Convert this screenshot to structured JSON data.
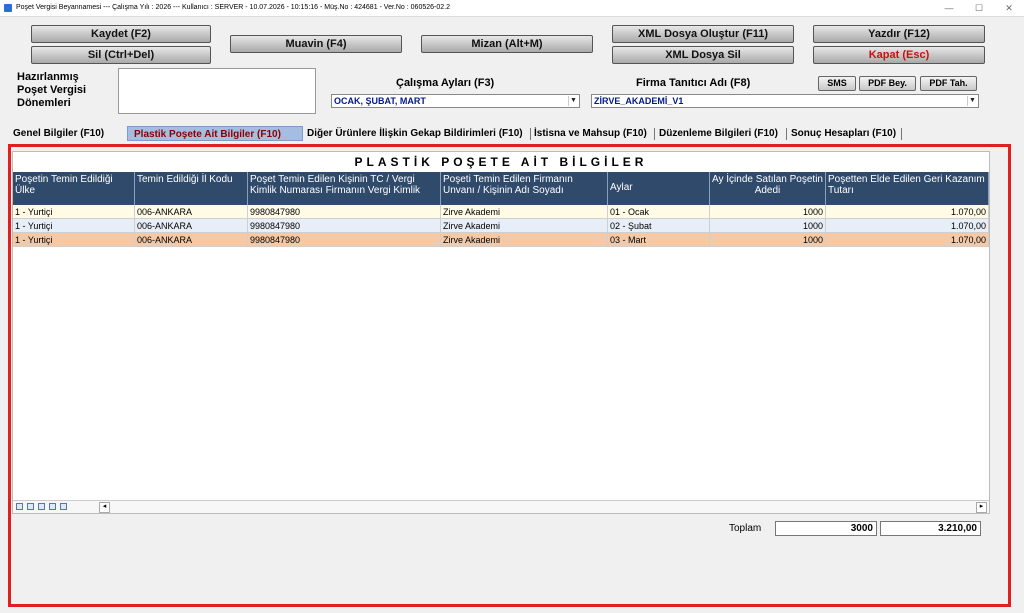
{
  "window": {
    "title": "Poşet Vergisi Beyannamesi  ---  Çalışma Yılı : 2026  ---  Kullanıcı : SERVER - 10.07.2026 - 10:15:16 - Müş.No : 424681 - Ver.No : 060526-02.2",
    "min": "—",
    "max": "☐",
    "close": "✕"
  },
  "toolbar": {
    "kaydet": "Kaydet (F2)",
    "sil": "Sil (Ctrl+Del)",
    "muavin": "Muavin (F4)",
    "mizan": "Mizan (Alt+M)",
    "xml_olustur": "XML Dosya Oluştur (F11)",
    "xml_sil": "XML Dosya Sil",
    "yazdir": "Yazdır (F12)",
    "kapat": "Kapat (Esc)"
  },
  "prepared": {
    "label_line1": "Hazırlanmış",
    "label_line2": "Poşet Vergisi",
    "label_line3": "Dönemleri"
  },
  "months": {
    "label": "Çalışma Ayları (F3)",
    "value": "OCAK, ŞUBAT, MART"
  },
  "company": {
    "label": "Firma Tanıtıcı Adı (F8)",
    "value": "ZİRVE_AKADEMİ_V1"
  },
  "small_buttons": {
    "sms": "SMS",
    "pdf_bey": "PDF Bey.",
    "pdf_tah": "PDF Tah."
  },
  "tabs": [
    {
      "label": "Genel Bilgiler (F10)"
    },
    {
      "label": "Plastik Poşete Ait Bilgiler (F10)"
    },
    {
      "label": "Diğer Ürünlere İlişkin Gekap Bildirimleri (F10)"
    },
    {
      "label": "İstisna ve Mahsup (F10)"
    },
    {
      "label": "Düzenleme Bilgileri (F10)"
    },
    {
      "label": "Sonuç Hesapları (F10)"
    }
  ],
  "grid": {
    "title": "PLASTİK POŞETE AİT BİLGİLER",
    "headers": [
      "Poşetin Temin Edildiği Ülke",
      "Temin Edildiği İl Kodu",
      "Poşet Temin Edilen Kişinin TC / Vergi Kimlik Numarası Firmanın Vergi Kimlik",
      "Poşeti Temin Edilen Firmanın Unvanı / Kişinin Adı Soyadı",
      "Aylar",
      "Ay İçinde Satılan Poşetin Adedi",
      "Poşetten Elde Edilen Geri Kazanım Tutarı"
    ],
    "rows": [
      [
        "1 - Yurtiçi",
        "006-ANKARA",
        "9980847980",
        "Zirve Akademi",
        "01 - Ocak",
        "1000",
        "1.070,00"
      ],
      [
        "1 - Yurtiçi",
        "006-ANKARA",
        "9980847980",
        "Zirve Akademi",
        "02 - Şubat",
        "1000",
        "1.070,00"
      ],
      [
        "1 - Yurtiçi",
        "006-ANKARA",
        "9980847980",
        "Zirve Akademi",
        "03 - Mart",
        "1000",
        "1.070,00"
      ]
    ],
    "row_colors": [
      "#fffbe6",
      "#e8eef8",
      "#f5c9a6"
    ]
  },
  "totals": {
    "label": "Toplam",
    "count": "3000",
    "amount": "3.210,00"
  }
}
